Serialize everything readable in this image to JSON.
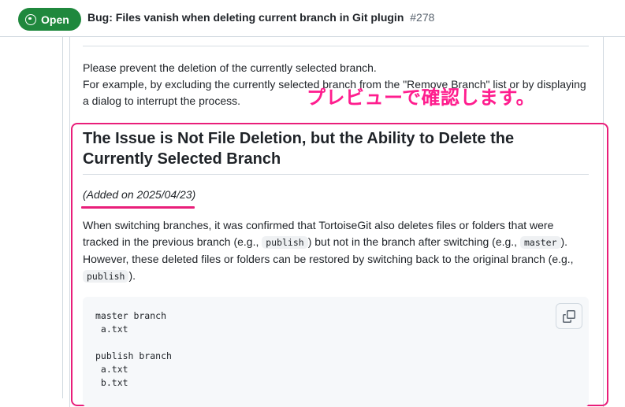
{
  "header": {
    "state": "Open",
    "title": "Bug: Files vanish when deleting current branch in Git plugin",
    "number": "#278"
  },
  "body": {
    "para1_line1": "Please prevent the deletion of the currently selected branch.",
    "para1_line2": "For example, by excluding the currently selected branch from the \"Remove Branch\" list or by displaying",
    "para1_line3": "a dialog to interrupt the process.",
    "overlay_note": "プレビューで確認します。",
    "section_heading": "The Issue is Not File Deletion, but the Ability to Delete the Currently Selected Branch",
    "added_note": "(Added on 2025/04/23)",
    "para2_line1": "When switching branches, it was confirmed that TortoiseGit also deletes files or folders that were",
    "para2_line2_a": "tracked in the previous branch (e.g., ",
    "para2_code1": "publish",
    "para2_line2_b": ") but not in the branch after switching (e.g., ",
    "para2_code2": "master",
    "para2_line2_c": ").",
    "para2_line3": "However, these deleted files or folders can be restored by switching back to the original branch (e.g.,",
    "para2_code3": "publish",
    "para2_line4_end": ")."
  },
  "code_block": {
    "line1": "master branch",
    "line2": " a.txt",
    "line3": "publish branch",
    "line4": " a.txt",
    "line5": " b.txt"
  },
  "icons": {
    "state": "issue-opened-icon",
    "copy": "copy-icon"
  },
  "colors": {
    "open_badge": "#1f883d",
    "highlight": "#e91e7a",
    "overlay_text": "#ff1d8e"
  }
}
